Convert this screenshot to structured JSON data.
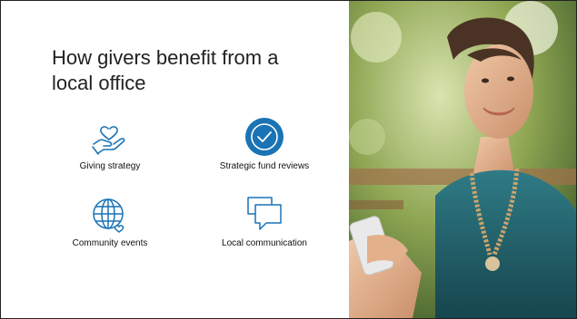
{
  "slide": {
    "title": "How givers benefit from a local office",
    "features": [
      {
        "label": "Giving strategy",
        "icon": "hand-heart-icon"
      },
      {
        "label": "Strategic fund reviews",
        "icon": "check-circle-icon"
      },
      {
        "label": "Community events",
        "icon": "globe-heart-icon"
      },
      {
        "label": "Local communication",
        "icon": "speech-bubbles-icon"
      }
    ]
  },
  "colors": {
    "icon_stroke": "#1a73b5",
    "accent_fill": "#1a73b5",
    "text": "#222222"
  },
  "image": {
    "description": "woman-smiling-holding-phone-photo"
  }
}
